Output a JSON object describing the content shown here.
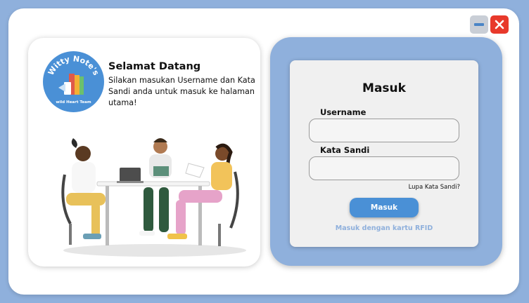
{
  "window": {
    "minimize_icon": "minimize-icon",
    "close_icon": "close-icon"
  },
  "welcome": {
    "logo_title": "Witty Note's",
    "logo_subtitle": "wild Heart Team",
    "title": "Selamat Datang",
    "text": "Silakan masukan Username dan Kata Sandi anda untuk masuk ke halaman utama!"
  },
  "login": {
    "title": "Masuk",
    "username_label": "Username",
    "username_value": "",
    "password_label": "Kata Sandi",
    "password_value": "",
    "forgot_label": "Lupa Kata Sandi?",
    "submit_label": "Masuk",
    "rfid_label": "Masuk dengan kartu RFID"
  },
  "colors": {
    "background": "#8fb0dc",
    "accent": "#4a90d6",
    "close": "#e8392b"
  }
}
